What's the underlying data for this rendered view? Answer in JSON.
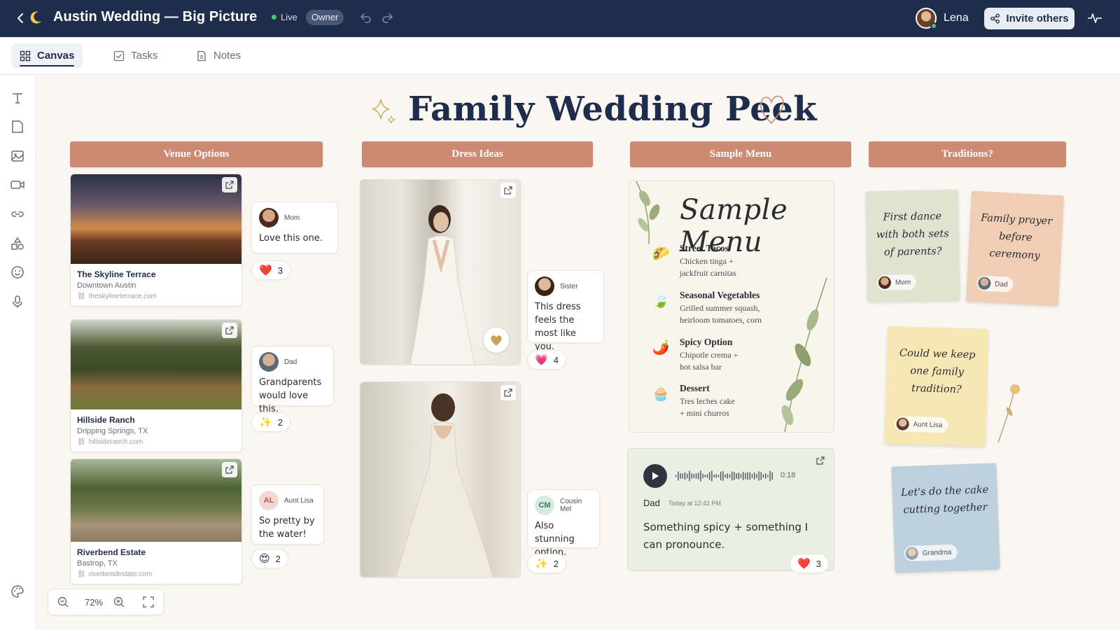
{
  "app": {
    "title": "Austin Wedding — Big Picture",
    "status": "Live",
    "role_badge": "Owner",
    "user_name": "Lena",
    "invite_label": "Invite others"
  },
  "tabs": [
    {
      "label": "Canvas",
      "icon": "grid-icon",
      "active": true
    },
    {
      "label": "Tasks",
      "icon": "checkbox-icon",
      "active": false
    },
    {
      "label": "Notes",
      "icon": "document-icon",
      "active": false
    }
  ],
  "tools": [
    "text-icon",
    "sticky-note-icon",
    "image-icon",
    "video-icon",
    "link-icon",
    "shapes-icon",
    "emoji-icon",
    "microphone-icon",
    "palette-icon"
  ],
  "board": {
    "title": "Family Wedding Peek",
    "columns": [
      "Venue Options",
      "Dress Ideas",
      "Sample Menu",
      "Traditions?"
    ]
  },
  "venues": [
    {
      "name": "The Skyline Terrace",
      "location": "Downtown Austin",
      "url": "theskylineterrace.com"
    },
    {
      "name": "Hillside Ranch",
      "location": "Dripping Springs, TX",
      "url": "hillsideranch.com"
    },
    {
      "name": "Riverbend Estate",
      "location": "Bastrop, TX",
      "url": "riverbendestate.com"
    }
  ],
  "comments": {
    "mom": {
      "name": "Mom",
      "text": "Love this one."
    },
    "dad": {
      "name": "Dad",
      "text": "Grandparents would love this."
    },
    "aunt": {
      "name": "Aunt Lisa",
      "initials": "AL",
      "text": "So pretty by the water!"
    },
    "sister": {
      "name": "Sister",
      "text": "This dress feels the most like you."
    },
    "cousin": {
      "name": "Cousin Mel",
      "initials": "CM",
      "text": "Also stunning option."
    }
  },
  "reactions": {
    "venue1": {
      "emoji": "❤️",
      "count": "3"
    },
    "venue2": {
      "emoji": "✨",
      "count": "2"
    },
    "venue3": {
      "emoji": "😍",
      "count": "2"
    },
    "dress1": {
      "emoji": "💗",
      "count": "4"
    },
    "dress2": {
      "emoji": "✨",
      "count": "2"
    },
    "voice": {
      "emoji": "❤️",
      "count": "3"
    }
  },
  "menu": {
    "title": "Sample Menu",
    "items": [
      {
        "name": "Street Tacos",
        "desc1": "Chicken tinga +",
        "desc2": "jackfruit carnitas",
        "icon": "🌮"
      },
      {
        "name": "Seasonal Vegetables",
        "desc1": "Grilled summer squash,",
        "desc2": "heirloom tomatoes, corn",
        "icon": "🍃"
      },
      {
        "name": "Spicy Option",
        "desc1": "Chipotle crema +",
        "desc2": "hot salsa bar",
        "icon": "🌶️"
      },
      {
        "name": "Dessert",
        "desc1": "Tres leches cake",
        "desc2": "+ mini churros",
        "icon": "🧁"
      }
    ]
  },
  "voice_note": {
    "duration": "0:18",
    "from": "Dad",
    "time": "Today at 12:42 PM",
    "text": "Something spicy + something I can pronounce."
  },
  "stickies": [
    {
      "text": "First dance with both sets of parents?",
      "author": "Mom",
      "color": "#dfe3cf"
    },
    {
      "text": "Family prayer before ceremony",
      "author": "Dad",
      "color": "#f0cdb5"
    },
    {
      "text": "Could we keep one family tradition?",
      "author": "Aunt Lisa",
      "color": "#f7e7b4"
    },
    {
      "text": "Let's do the cake cutting together",
      "author": "Grandma",
      "color": "#bdd0de"
    }
  ],
  "zoom": {
    "level": "72%"
  },
  "colors": {
    "topbar": "#1f2d4d",
    "header": "#cd8a72",
    "canvas": "#faf6f1"
  }
}
